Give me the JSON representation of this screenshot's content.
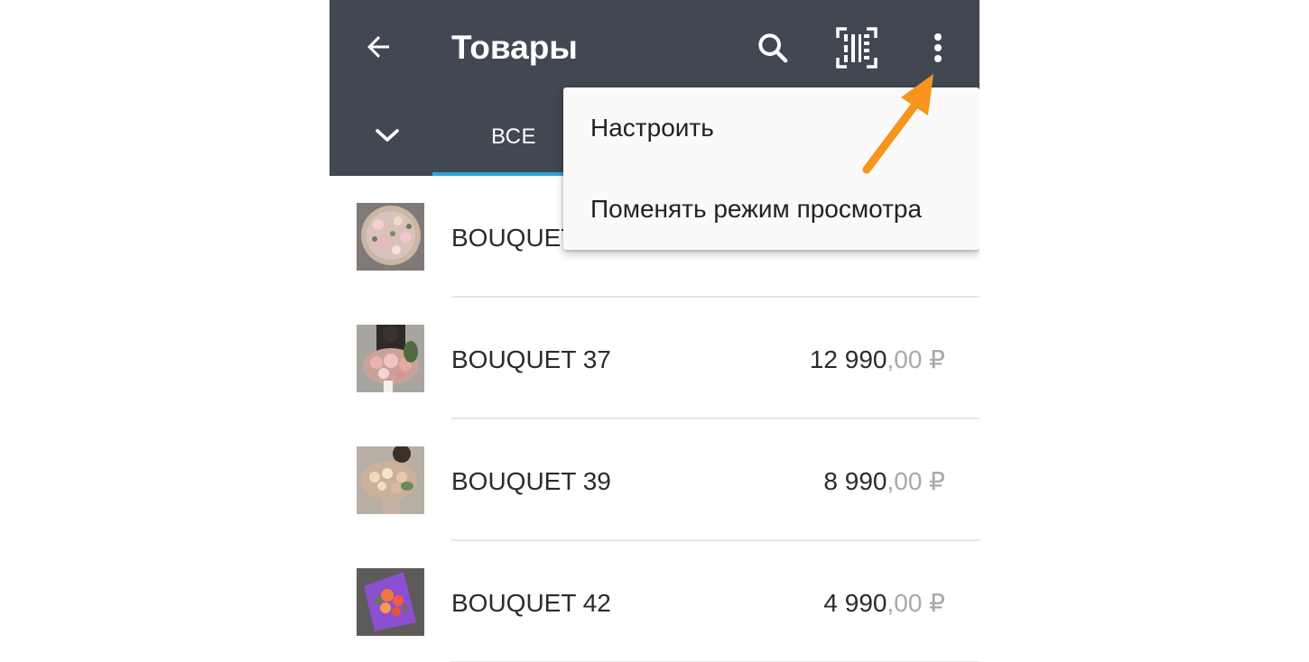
{
  "appbar": {
    "title": "Товары",
    "icons": [
      "back-arrow-icon",
      "search-icon",
      "barcode-scan-icon",
      "more-vert-icon",
      "chevron-down-icon"
    ],
    "background": "#424852"
  },
  "tabs": [
    {
      "label": "ВСЕ",
      "active": true
    }
  ],
  "accent_color": "#2ea6e0",
  "products": [
    {
      "name": "BOUQUET",
      "price_main": "",
      "price_cents": ""
    },
    {
      "name": "BOUQUET 37",
      "price_main": "12 990",
      "price_cents": ",00 ₽"
    },
    {
      "name": "BOUQUET 39",
      "price_main": "8 990",
      "price_cents": ",00 ₽"
    },
    {
      "name": "BOUQUET 42",
      "price_main": "4 990",
      "price_cents": ",00 ₽"
    }
  ],
  "overflow_menu": {
    "items": [
      {
        "label": "Настроить"
      },
      {
        "label": "Поменять режим просмотра"
      }
    ]
  },
  "annotation": {
    "arrow_color": "#f7941d"
  }
}
